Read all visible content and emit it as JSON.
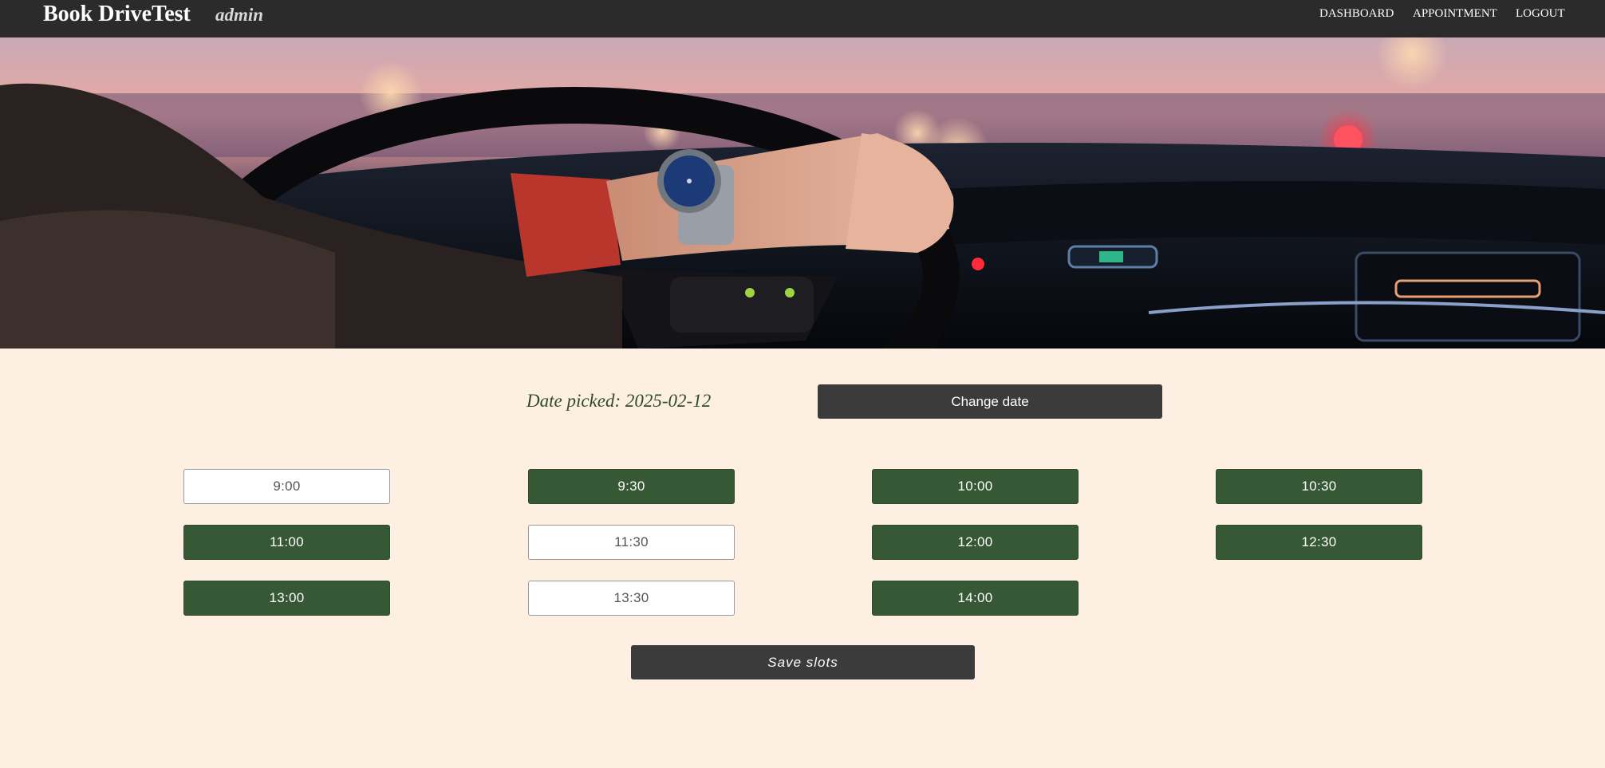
{
  "navbar": {
    "brand": "Book DriveTest",
    "role": "admin",
    "links": [
      "DASHBOARD",
      "APPOINTMENT",
      "LOGOUT"
    ]
  },
  "hero": {
    "image": "driver-hands-on-steering-wheel-at-dusk",
    "colors": {
      "sky": "#e9a9a0",
      "dashboard": "#10141c",
      "sleeve": "#b8362b"
    }
  },
  "date": {
    "label": "Date picked: 2025-02-12",
    "change_button": "Change date"
  },
  "slots": [
    {
      "time": "9:00",
      "selected": false
    },
    {
      "time": "9:30",
      "selected": true
    },
    {
      "time": "10:00",
      "selected": true
    },
    {
      "time": "10:30",
      "selected": true
    },
    {
      "time": "11:00",
      "selected": true
    },
    {
      "time": "11:30",
      "selected": false
    },
    {
      "time": "12:00",
      "selected": true
    },
    {
      "time": "12:30",
      "selected": true
    },
    {
      "time": "13:00",
      "selected": true
    },
    {
      "time": "13:30",
      "selected": false
    },
    {
      "time": "14:00",
      "selected": true
    }
  ],
  "save_button": "Save slots",
  "colors": {
    "page_bg": "#fdf0e3",
    "navbar_bg": "#2b2b2b",
    "slot_selected": "#375834",
    "slot_unselected": "#ffffff",
    "button_dark": "#3b3b3b"
  }
}
